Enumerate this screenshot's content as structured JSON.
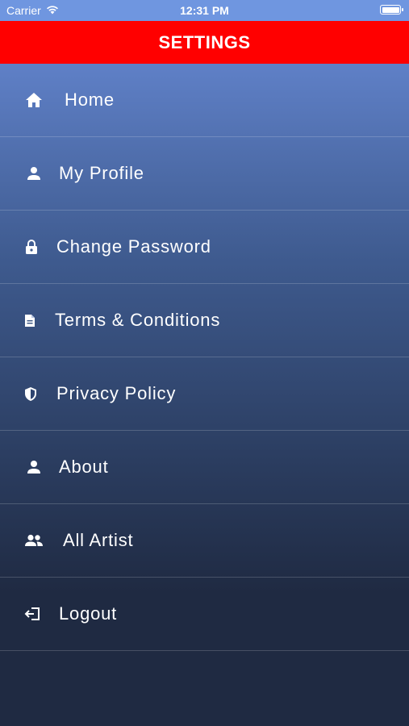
{
  "status_bar": {
    "carrier": "Carrier",
    "time": "12:31 PM"
  },
  "header": {
    "title": "SETTINGS"
  },
  "menu": {
    "items": [
      {
        "label": "Home",
        "icon": "home-icon"
      },
      {
        "label": "My Profile",
        "icon": "person-icon"
      },
      {
        "label": "Change Password",
        "icon": "lock-icon"
      },
      {
        "label": "Terms & Conditions",
        "icon": "document-icon"
      },
      {
        "label": "Privacy Policy",
        "icon": "shield-icon"
      },
      {
        "label": "About",
        "icon": "person-icon"
      },
      {
        "label": "All Artist",
        "icon": "people-icon"
      },
      {
        "label": "Logout",
        "icon": "logout-icon"
      }
    ]
  },
  "colors": {
    "header_bg": "#ff0000",
    "menu_top": "#5f80c7",
    "menu_bottom": "#1f2a42",
    "text": "#ffffff"
  }
}
